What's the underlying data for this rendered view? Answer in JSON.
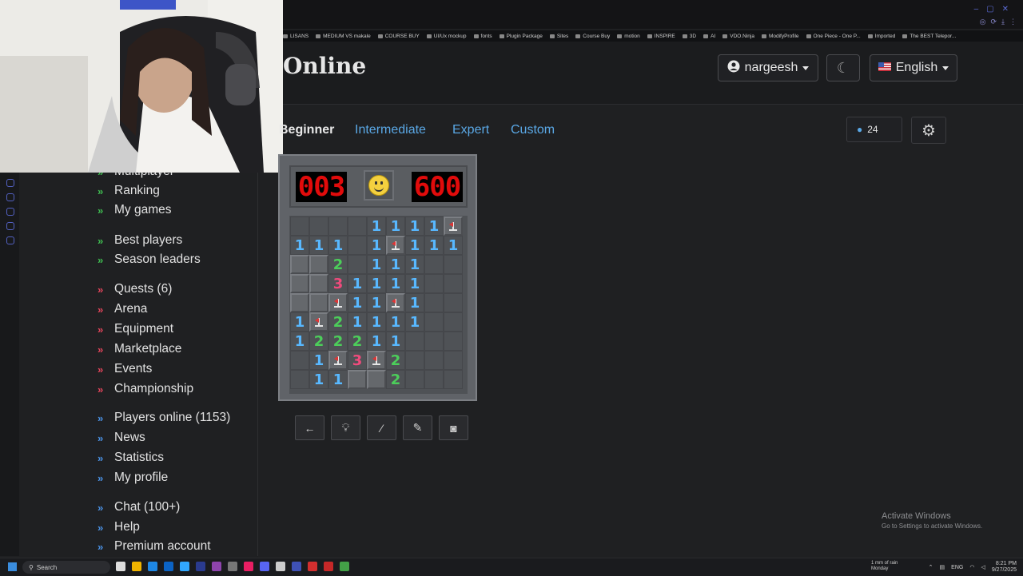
{
  "site": {
    "title": "Online"
  },
  "header": {
    "user": "nargeesh",
    "language": "English"
  },
  "bookmarks": [
    "LISANS",
    "MEDIUM VS makale",
    "COURSE BUY",
    "UI/Ux mockup",
    "fonts",
    "Plugin Package",
    "Sites",
    "Course Buy",
    "motion",
    "INSPIRE",
    "3D",
    "AI",
    "VDO.Ninja",
    "ModifyProfile",
    "One Piece - One P...",
    "Imported",
    "The BEST Telepor..."
  ],
  "sidebar": {
    "partial_top": "Multiplayer",
    "items": [
      {
        "label": "Ranking",
        "color": "green"
      },
      {
        "label": "My games",
        "color": "green"
      },
      {
        "label": "Best players",
        "color": "green"
      },
      {
        "label": "Season leaders",
        "color": "green"
      },
      {
        "label": "Quests (6)",
        "color": "red"
      },
      {
        "label": "Arena",
        "color": "red"
      },
      {
        "label": "Equipment",
        "color": "red"
      },
      {
        "label": "Marketplace",
        "color": "red"
      },
      {
        "label": "Events",
        "color": "red"
      },
      {
        "label": "Championship",
        "color": "red"
      },
      {
        "label": "Players online (1153)",
        "color": "blue"
      },
      {
        "label": "News",
        "color": "blue"
      },
      {
        "label": "Statistics",
        "color": "blue"
      },
      {
        "label": "My profile",
        "color": "blue"
      },
      {
        "label": "Chat (100+)",
        "color": "blue"
      },
      {
        "label": "Help",
        "color": "blue"
      },
      {
        "label": "Premium account",
        "color": "blue"
      }
    ]
  },
  "tabs": [
    "Beginner",
    "Intermediate",
    "Expert",
    "Custom"
  ],
  "active_tab": "Beginner",
  "zoom": "24",
  "game": {
    "mines_left": "003",
    "timer": "600",
    "board": [
      [
        "",
        "",
        "",
        "",
        "1",
        "1",
        "1",
        "1",
        "F"
      ],
      [
        "1",
        "1",
        "1",
        "",
        "1",
        "F",
        "1",
        "1",
        "1"
      ],
      [
        "#",
        "#",
        "2",
        "",
        "1",
        "1",
        "1",
        "",
        ""
      ],
      [
        "#",
        "#",
        "3",
        "1",
        "1",
        "1",
        "1",
        "",
        ""
      ],
      [
        "#",
        "#",
        "F",
        "1",
        "1",
        "F",
        "1",
        "",
        ""
      ],
      [
        "1",
        "F",
        "2",
        "1",
        "1",
        "1",
        "1",
        "",
        ""
      ],
      [
        "1",
        "2",
        "2",
        "2",
        "1",
        "1",
        "",
        "",
        ""
      ],
      [
        "",
        "1",
        "F",
        "3",
        "F",
        "2",
        "",
        "",
        ""
      ],
      [
        "",
        "1",
        "1",
        "#",
        "#",
        "2",
        "",
        "",
        ""
      ]
    ]
  },
  "colors": {
    "one": "#58b8ff",
    "two": "#4cce5a",
    "three": "#ef4b7c",
    "counter": "#e10b0b"
  },
  "watermark": {
    "line1": "Activate Windows",
    "line2": "Go to Settings to activate Windows."
  },
  "taskbar": {
    "search": "Search",
    "weather_line1": "1 mm of rain",
    "weather_line2": "Monday",
    "lang": "ENG",
    "time": "8:21 PM",
    "date": "9/27/2025"
  }
}
